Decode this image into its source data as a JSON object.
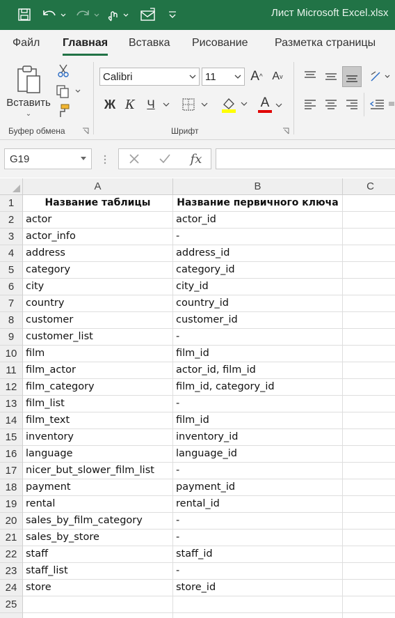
{
  "titlebar": {
    "title": "Лист Microsoft Excel.xlsx"
  },
  "menu": {
    "file": "Файл",
    "home": "Главная",
    "insert": "Вставка",
    "draw": "Рисование",
    "page_layout": "Разметка страницы"
  },
  "ribbon": {
    "paste_label": "Вставить",
    "clipboard_group": "Буфер обмена",
    "font_group": "Шрифт",
    "font_name": "Calibri",
    "font_size": "11",
    "bold": "Ж",
    "italic": "К",
    "underline": "Ч",
    "font_color_letter": "A",
    "font_color": "#e00000",
    "highlight_color": "#ffff00"
  },
  "formula_bar": {
    "name_box": "G19",
    "fx": "fx",
    "formula": ""
  },
  "sheet": {
    "columns": [
      "A",
      "B",
      "C"
    ],
    "header": {
      "a": "Название таблицы",
      "b": "Название первичного ключа"
    },
    "rows": [
      {
        "n": "2",
        "a": "actor",
        "b": "actor_id"
      },
      {
        "n": "3",
        "a": "actor_info",
        "b": "-"
      },
      {
        "n": "4",
        "a": "address",
        "b": "address_id"
      },
      {
        "n": "5",
        "a": "category",
        "b": "category_id"
      },
      {
        "n": "6",
        "a": "city",
        "b": "city_id"
      },
      {
        "n": "7",
        "a": "country",
        "b": "country_id"
      },
      {
        "n": "8",
        "a": "customer",
        "b": "customer_id"
      },
      {
        "n": "9",
        "a": "customer_list",
        "b": "-"
      },
      {
        "n": "10",
        "a": "film",
        "b": "film_id"
      },
      {
        "n": "11",
        "a": "film_actor",
        "b": "actor_id, film_id"
      },
      {
        "n": "12",
        "a": "film_category",
        "b": "film_id, category_id"
      },
      {
        "n": "13",
        "a": "film_list",
        "b": "-"
      },
      {
        "n": "14",
        "a": "film_text",
        "b": "film_id"
      },
      {
        "n": "15",
        "a": "inventory",
        "b": "inventory_id"
      },
      {
        "n": "16",
        "a": "language",
        "b": "language_id"
      },
      {
        "n": "17",
        "a": "nicer_but_slower_film_list",
        "b": "-"
      },
      {
        "n": "18",
        "a": "payment",
        "b": "payment_id"
      },
      {
        "n": "19",
        "a": "rental",
        "b": "rental_id"
      },
      {
        "n": "20",
        "a": "sales_by_film_category",
        "b": "-"
      },
      {
        "n": "21",
        "a": "sales_by_store",
        "b": "-"
      },
      {
        "n": "22",
        "a": "staff",
        "b": "staff_id"
      },
      {
        "n": "23",
        "a": "staff_list",
        "b": "-"
      },
      {
        "n": "24",
        "a": "store",
        "b": "store_id"
      },
      {
        "n": "25",
        "a": "",
        "b": ""
      }
    ]
  }
}
